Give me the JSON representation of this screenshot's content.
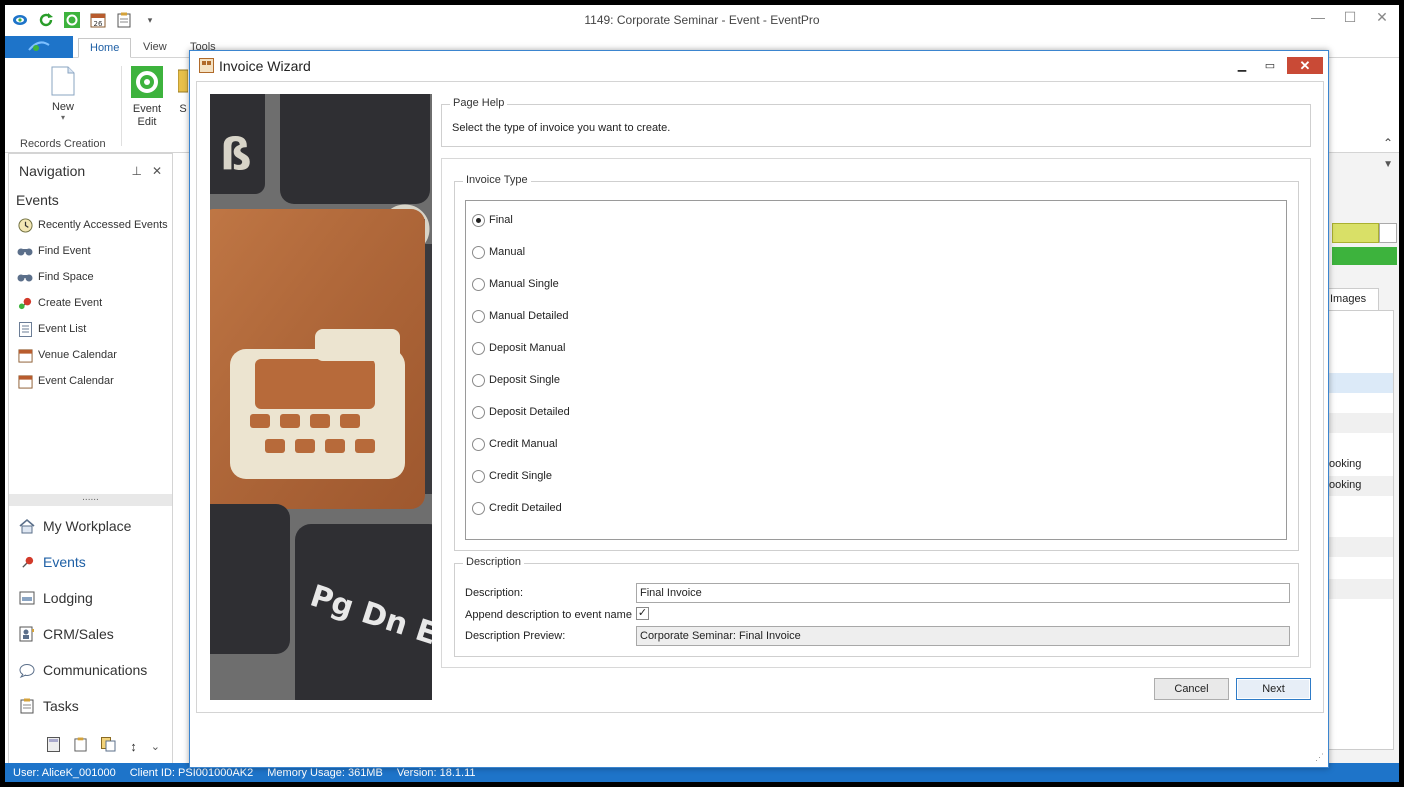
{
  "app": {
    "title": "1149: Corporate Seminar - Event - EventPro",
    "tabs": [
      "Home",
      "View",
      "Tools"
    ],
    "ribbon": {
      "new_label": "New",
      "event_edit_label": "Event\nEdit",
      "s_label": "S",
      "group_records": "Records Creation"
    },
    "colors": {
      "accent": "#1e74c9",
      "close_red": "#c94a36",
      "green": "#3db33d"
    }
  },
  "navigation": {
    "title": "Navigation",
    "section": "Events",
    "items": [
      {
        "label": "Recently Accessed Events",
        "icon": "clock-icon"
      },
      {
        "label": "Find Event",
        "icon": "binoculars-icon"
      },
      {
        "label": "Find Space",
        "icon": "binoculars-icon"
      },
      {
        "label": "Create Event",
        "icon": "pushpin-add-icon"
      },
      {
        "label": "Event List",
        "icon": "list-icon"
      },
      {
        "label": "Venue Calendar",
        "icon": "calendar-icon"
      },
      {
        "label": "Event Calendar",
        "icon": "calendar-icon"
      }
    ],
    "modules": [
      {
        "label": "My Workplace",
        "icon": "house-icon"
      },
      {
        "label": "Events",
        "icon": "pushpin-icon"
      },
      {
        "label": "Lodging",
        "icon": "bed-icon"
      },
      {
        "label": "CRM/Sales",
        "icon": "contacts-icon"
      },
      {
        "label": "Communications",
        "icon": "speech-bubble-icon"
      },
      {
        "label": "Tasks",
        "icon": "clipboard-icon"
      }
    ],
    "splitter_dots": "......"
  },
  "background": {
    "images_tab": "Images",
    "row1": "ooking",
    "row2": "ooking"
  },
  "status": {
    "user": "User: AliceK_001000",
    "client": "Client ID: PSI001000AK2",
    "memory": "Memory Usage: 361MB",
    "version": "Version: 18.1.11"
  },
  "wizard": {
    "title": "Invoice Wizard",
    "page_help_legend": "Page Help",
    "page_help_text": "Select the type of invoice you want to create.",
    "invoice_type_legend": "Invoice Type",
    "invoice_types": [
      "Final",
      "Manual",
      "Manual Single",
      "Manual Detailed",
      "Deposit Manual",
      "Deposit Single",
      "Deposit Detailed",
      "Credit Manual",
      "Credit Single",
      "Credit Detailed"
    ],
    "selected_type": "Final",
    "description_legend": "Description",
    "description_label": "Description:",
    "description_value": "Final Invoice",
    "append_label": "Append description to event name",
    "append_checked": true,
    "check_mark": "✓",
    "preview_label": "Description Preview:",
    "preview_value": "Corporate Seminar: Final Invoice",
    "image_key_labels": [
      "Pg Dn E"
    ],
    "cancel_label": "Cancel",
    "next_label": "Next"
  }
}
